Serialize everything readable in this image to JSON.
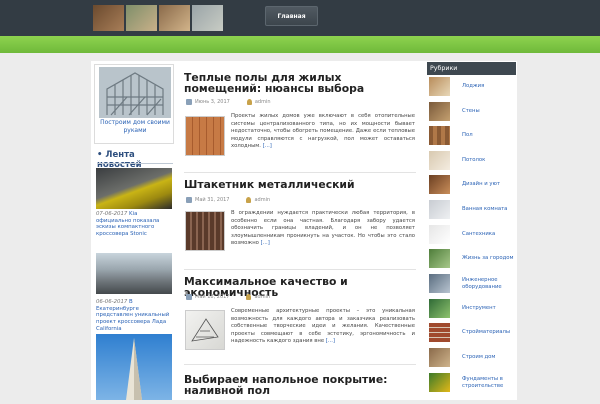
{
  "header": {
    "nav": {
      "home": "Главная"
    },
    "colors": {
      "topbar": "#333c44",
      "accent_green": "#7ac143",
      "link": "#2a62b5"
    }
  },
  "left_sidebar": {
    "house_caption": "Построим дом своими руками",
    "news_title": "• Лента новостей",
    "news": [
      {
        "date": "07-06-2017",
        "text": "Kia официально показала эскизы компактного кроссовера Stonic"
      },
      {
        "date": "06-06-2017",
        "text": "В Екатеринбурге представлен уникальный проект кроссовера Лада California"
      }
    ]
  },
  "posts": [
    {
      "title": "Теплые полы для жилых помещений: нюансы выбора",
      "date": "Июнь 3, 2017",
      "author": "admin",
      "excerpt": "Проекты жилых домов уже включают в себя отопительные системы централизованного типа, но их мощности бывает недостаточно, чтобы обогреть помещение. Даже если тепловые модули справляются с нагрузкой, пол может оставаться холодным.",
      "more": "[...]"
    },
    {
      "title": "Штакетник металлический",
      "date": "Май 31, 2017",
      "author": "admin",
      "excerpt": "В ограждении нуждается практически любая территория, в особенно если она частная. Благодаря забору удается обозначить границы владений, и он не позволяет злоумышленникам проникнуть на участок. Но чтобы это стало возможно",
      "more": "[...]"
    },
    {
      "title": "Максимальное качество и экономичность",
      "date": "Май 18, 2017",
      "author": "admin",
      "excerpt": "Современные архитектурные проекты – это уникальная возможность для каждого автора и заказчика реализовать собственные творческие идеи и желания. Качественные проекты совмещают в себе эстетику, эргономичность и надежность каждого здания вне",
      "more": "[...]"
    },
    {
      "title": "Выбираем напольное покрытие: наливной пол"
    }
  ],
  "right_sidebar": {
    "heading": "Рубрики",
    "items": [
      {
        "label": "Лоджия",
        "icon": "loggia-thumb"
      },
      {
        "label": "Стены",
        "icon": "walls-thumb"
      },
      {
        "label": "Пол",
        "icon": "floor-thumb"
      },
      {
        "label": "Потолок",
        "icon": "ceiling-thumb"
      },
      {
        "label": "Дизайн и уют",
        "icon": "design-thumb"
      },
      {
        "label": "Ванная комната",
        "icon": "bathroom-thumb"
      },
      {
        "label": "Сантехника",
        "icon": "plumbing-thumb"
      },
      {
        "label": "Жизнь за городом",
        "icon": "country-life-thumb"
      },
      {
        "label": "Инженерное оборудование",
        "icon": "engineering-thumb"
      },
      {
        "label": "Инструмент",
        "icon": "tools-thumb"
      },
      {
        "label": "Стройматериалы",
        "icon": "materials-thumb"
      },
      {
        "label": "Строим дом",
        "icon": "building-thumb"
      },
      {
        "label": "Фундаменты в строительстве",
        "icon": "foundation-thumb"
      }
    ]
  }
}
